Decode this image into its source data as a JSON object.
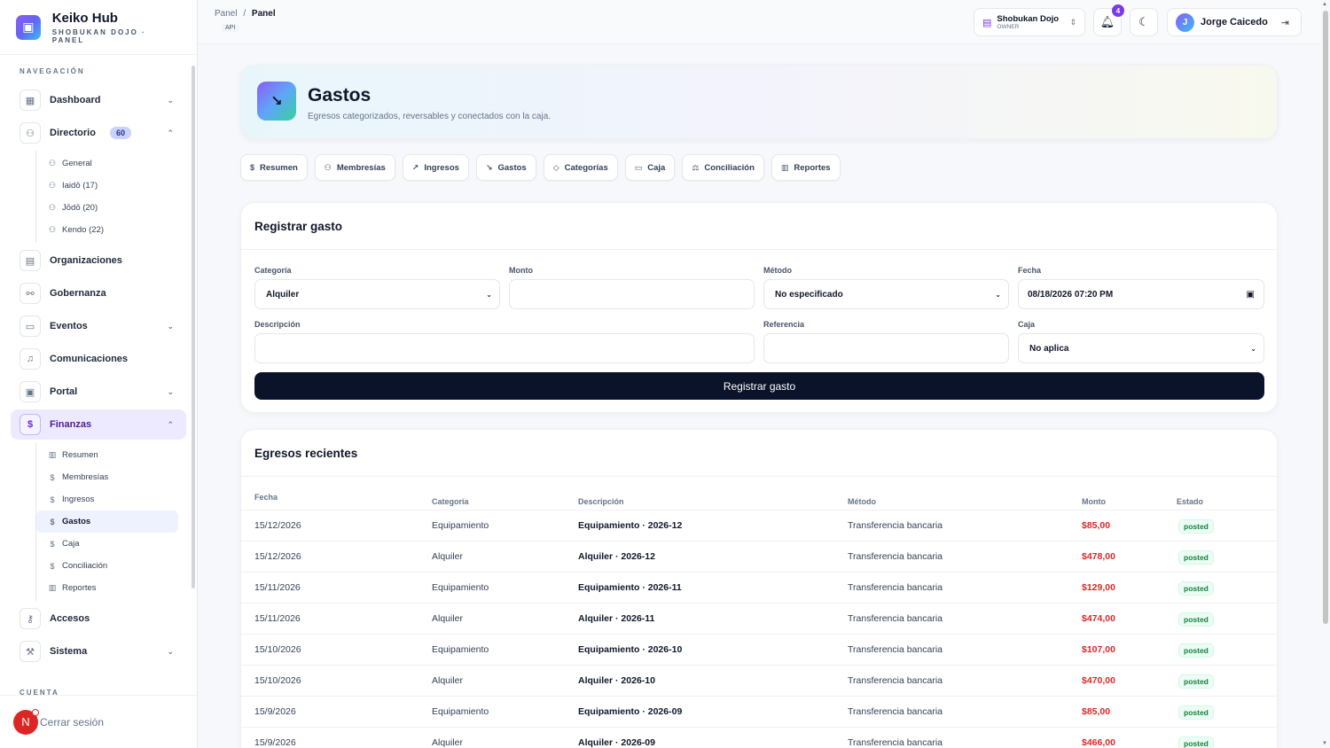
{
  "brand": {
    "title": "Keiko Hub",
    "subtitle": "SHOBUKAN DOJO · PANEL",
    "logo_icon": "layout-icon"
  },
  "sidebar": {
    "section_nav": "NAVEGACIÓN",
    "section_account": "CUENTA",
    "items": [
      {
        "label": "Dashboard",
        "icon": "grid-icon"
      },
      {
        "label": "Directorio",
        "icon": "users-icon",
        "badge": "60"
      },
      {
        "label": "Organizaciones",
        "icon": "building-icon"
      },
      {
        "label": "Gobernanza",
        "icon": "network-icon"
      },
      {
        "label": "Eventos",
        "icon": "calendar-icon"
      },
      {
        "label": "Comunicaciones",
        "icon": "bell-icon"
      },
      {
        "label": "Portal",
        "icon": "card-icon"
      },
      {
        "label": "Finanzas",
        "icon": "dollar-icon"
      },
      {
        "label": "Accesos",
        "icon": "key-icon"
      },
      {
        "label": "Sistema",
        "icon": "wrench-icon"
      }
    ],
    "directorio_sub": [
      "General",
      "Iaidō (17)",
      "Jōdō (20)",
      "Kendo (22)"
    ],
    "finanzas_sub": [
      "Resumen",
      "Membresías",
      "Ingresos",
      "Gastos",
      "Caja",
      "Conciliación",
      "Reportes"
    ],
    "logout_avatar": "N",
    "logout_label": "Cerrar sesión"
  },
  "topbar": {
    "breadcrumb_root": "Panel",
    "breadcrumb_sep": "/",
    "breadcrumb_current": "Panel",
    "api_tag": "API",
    "org_name": "Shobukan Dojo",
    "org_role": "OWNER",
    "notifications_count": "4",
    "user_initial": "J",
    "user_name": "Jorge Caicedo"
  },
  "hero": {
    "title": "Gastos",
    "subtitle": "Egresos categorizados, reversables y conectados con la caja."
  },
  "tabs": [
    {
      "label": "Resumen",
      "icon": "dollar-icon"
    },
    {
      "label": "Membresías",
      "icon": "users-icon"
    },
    {
      "label": "Ingresos",
      "icon": "arrow-up-right-icon"
    },
    {
      "label": "Gastos",
      "icon": "arrow-down-right-icon"
    },
    {
      "label": "Categorías",
      "icon": "tag-icon"
    },
    {
      "label": "Caja",
      "icon": "cash-icon"
    },
    {
      "label": "Conciliación",
      "icon": "scale-icon"
    },
    {
      "label": "Reportes",
      "icon": "chart-icon"
    }
  ],
  "form": {
    "title": "Registrar gasto",
    "categoria_label": "Categoría",
    "categoria_value": "Alquiler",
    "monto_label": "Monto",
    "monto_value": "",
    "metodo_label": "Método",
    "metodo_value": "No especificado",
    "fecha_label": "Fecha",
    "fecha_value": "08/18/2026 07:20 PM",
    "descripcion_label": "Descripción",
    "descripcion_value": "",
    "referencia_label": "Referencia",
    "referencia_value": "",
    "caja_label": "Caja",
    "caja_value": "No aplica",
    "submit_label": "Registrar gasto"
  },
  "table": {
    "title": "Egresos recientes",
    "columns": [
      "Fecha",
      "Categoría",
      "Descripción",
      "Método",
      "Monto",
      "Estado"
    ],
    "rows": [
      [
        "15/12/2026",
        "Equipamiento",
        "Equipamiento · 2026-12",
        "Transferencia bancaria",
        "$85,00",
        "posted"
      ],
      [
        "15/12/2026",
        "Alquiler",
        "Alquiler · 2026-12",
        "Transferencia bancaria",
        "$478,00",
        "posted"
      ],
      [
        "15/11/2026",
        "Equipamiento",
        "Equipamiento · 2026-11",
        "Transferencia bancaria",
        "$129,00",
        "posted"
      ],
      [
        "15/11/2026",
        "Alquiler",
        "Alquiler · 2026-11",
        "Transferencia bancaria",
        "$474,00",
        "posted"
      ],
      [
        "15/10/2026",
        "Equipamiento",
        "Equipamiento · 2026-10",
        "Transferencia bancaria",
        "$107,00",
        "posted"
      ],
      [
        "15/10/2026",
        "Alquiler",
        "Alquiler · 2026-10",
        "Transferencia bancaria",
        "$470,00",
        "posted"
      ],
      [
        "15/9/2026",
        "Equipamiento",
        "Equipamiento · 2026-09",
        "Transferencia bancaria",
        "$85,00",
        "posted"
      ],
      [
        "15/9/2026",
        "Alquiler",
        "Alquiler · 2026-09",
        "Transferencia bancaria",
        "$466,00",
        "posted"
      ]
    ]
  },
  "colors": {
    "accent": "#7c3aed",
    "button_dark": "#0b132b",
    "amount_red": "#dc2626",
    "status_green": "#15803d"
  }
}
